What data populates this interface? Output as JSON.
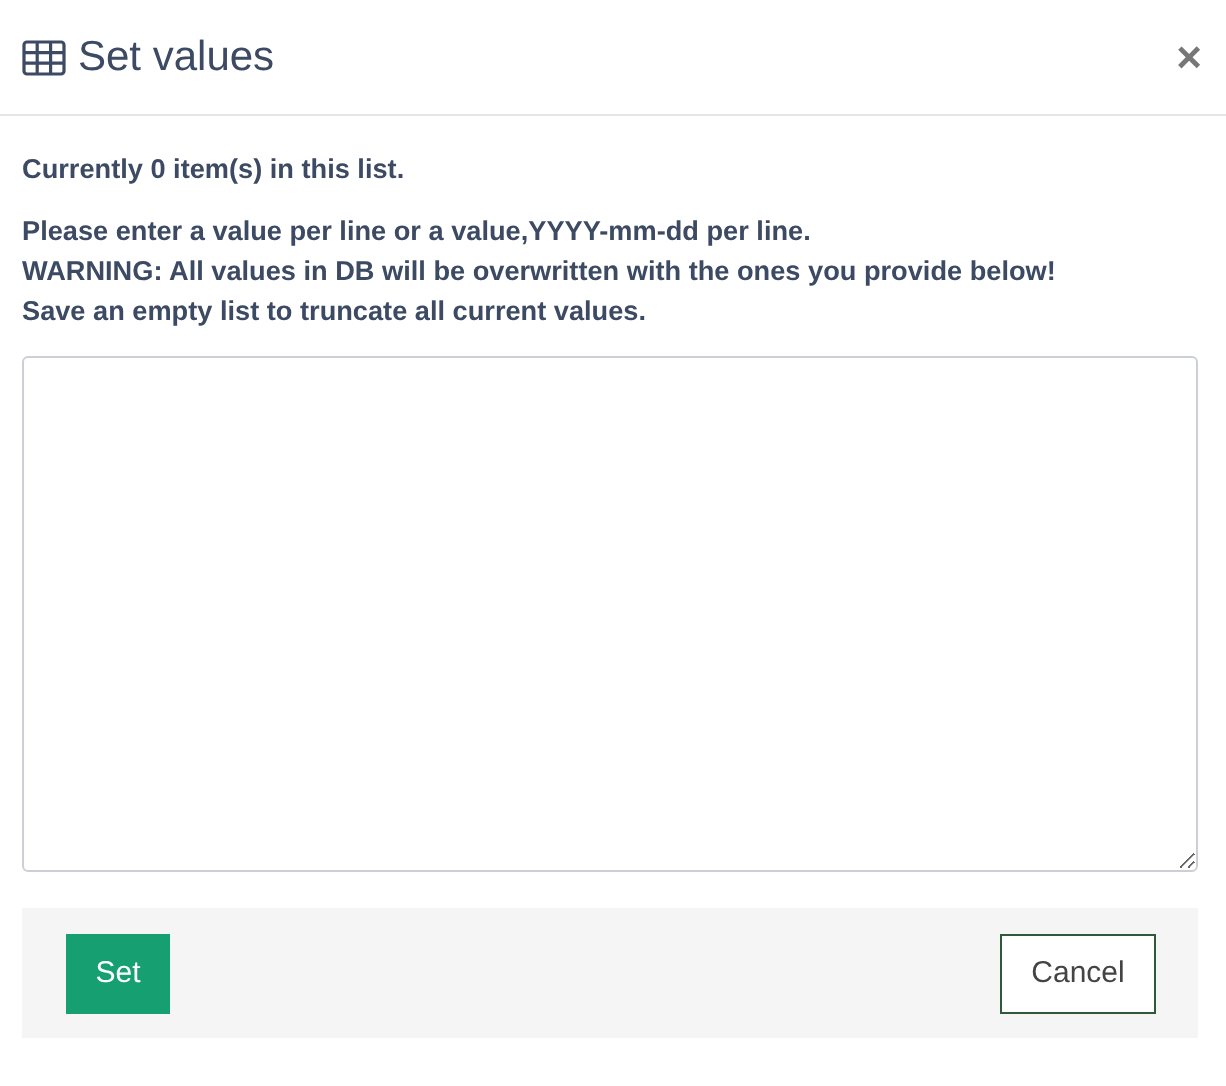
{
  "dialog": {
    "title": "Set values",
    "close": "×"
  },
  "messages": [
    "Currently 0 item(s) in this list."
  ],
  "instructions": [
    "Please enter a value per line or a value,YYYY-mm-dd per line.",
    "WARNING: All values in DB will be overwritten with the ones you provide below!",
    "Save an empty list to truncate all current values."
  ],
  "buttons": [
    {
      "label": "Set",
      "kind": "primary"
    },
    {
      "label": "Cancel",
      "kind": "secondary"
    }
  ]
}
